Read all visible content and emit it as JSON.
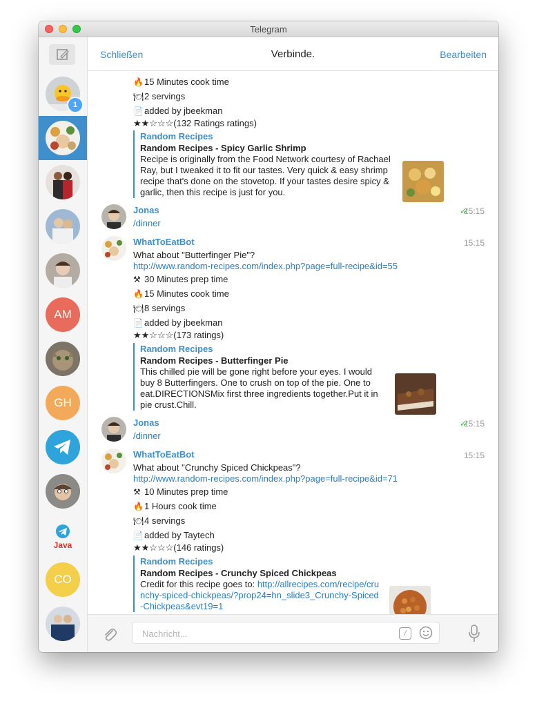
{
  "window": {
    "title": "Telegram"
  },
  "header": {
    "left": "Schließen",
    "title": "Verbinde.",
    "right": "Bearbeiten"
  },
  "sidebar": {
    "unread_badge": "1",
    "initials": [
      "AM",
      "GH",
      "CO"
    ],
    "java_label": "Java"
  },
  "messages": {
    "m0": {
      "cook": "15 Minutes cook time",
      "servings": "2 servings",
      "added": "added by jbeekman",
      "rating": "★★☆☆☆(132 Ratings ratings)",
      "preview": {
        "site": "Random Recipes",
        "title": "Random Recipes - Spicy Garlic Shrimp",
        "desc": "Recipe is originally from the Food Network courtesy of Rachael Ray, but I tweaked it to fit our tastes. Very quick & easy shrimp recipe that's done on the stovetop. If your tastes desire spicy & garlic, then this recipe is just for you."
      }
    },
    "m1": {
      "sender": "Jonas",
      "text": "/dinner",
      "time": "15:15"
    },
    "m2": {
      "sender": "WhatToEatBot",
      "time": "15:15",
      "question": "What about \"Butterfinger Pie\"?",
      "url": "http://www.random-recipes.com/index.php?page=full-recipe&id=55",
      "prep": "30 Minutes prep time",
      "cook": "15 Minutes cook time",
      "servings": "8 servings",
      "added": "added by jbeekman",
      "rating": "★★☆☆☆(173 ratings)",
      "preview": {
        "site": "Random Recipes",
        "title": "Random Recipes - Butterfinger Pie",
        "desc": "This chilled pie will be gone right before your eyes. I would buy 8 Butterfingers. One to crush on top of the pie. One to eat.DIRECTIONSMix first three ingredients together.Put it in pie crust.Chill."
      }
    },
    "m3": {
      "sender": "Jonas",
      "text": "/dinner",
      "time": "15:15"
    },
    "m4": {
      "sender": "WhatToEatBot",
      "time": "15:15",
      "question": "What about \"Crunchy Spiced Chickpeas\"?",
      "url": "http://www.random-recipes.com/index.php?page=full-recipe&id=71",
      "prep": "10 Minutes prep time",
      "cook": "1 Hours cook time",
      "servings": "4 servings",
      "added": "added by Taytech",
      "rating": "★★☆☆☆(146 ratings)",
      "preview": {
        "site": "Random Recipes",
        "title": "Random Recipes - Crunchy Spiced Chickpeas",
        "desc_prefix": "Credit for this recipe goes to: ",
        "desc_link": "http://allrecipes.com/recipe/crunchy-spiced-chickpeas/?prop24=hn_slide3_Crunchy-Spiced-Chickpeas&evt19=1"
      }
    }
  },
  "composer": {
    "placeholder": "Nachricht...",
    "command_label": "/"
  }
}
